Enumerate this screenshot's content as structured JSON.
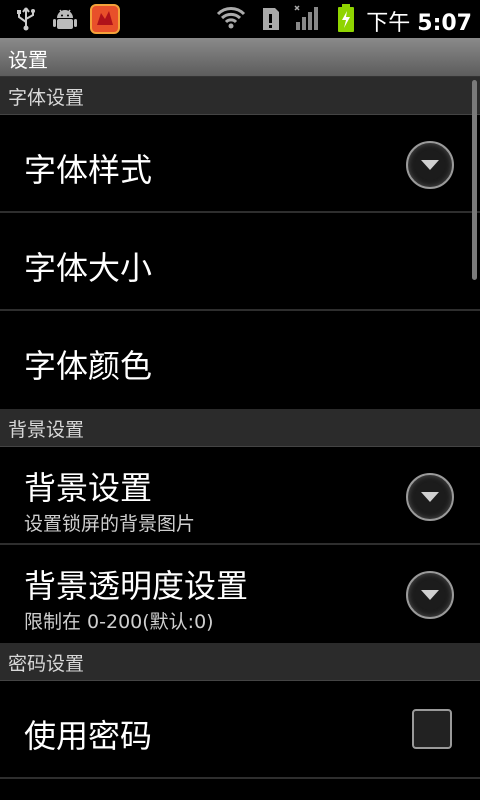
{
  "status": {
    "time_prefix": "下午",
    "time": "5:07",
    "icons": [
      "usb-icon",
      "android-debug-icon",
      "app-notification-icon",
      "wifi-icon",
      "sd-warning-icon",
      "signal-icon",
      "battery-charging-icon"
    ]
  },
  "titlebar": {
    "title": "设置"
  },
  "sections": {
    "font": {
      "header": "字体设置",
      "style": "字体样式",
      "size": "字体大小",
      "color": "字体颜色"
    },
    "background": {
      "header": "背景设置",
      "bg_title": "背景设置",
      "bg_summary": "设置锁屏的背景图片",
      "alpha_title": "背景透明度设置",
      "alpha_summary": "限制在 0-200(默认:0)"
    },
    "password": {
      "header": "密码设置",
      "use_password": "使用密码",
      "use_password_checked": false
    }
  }
}
